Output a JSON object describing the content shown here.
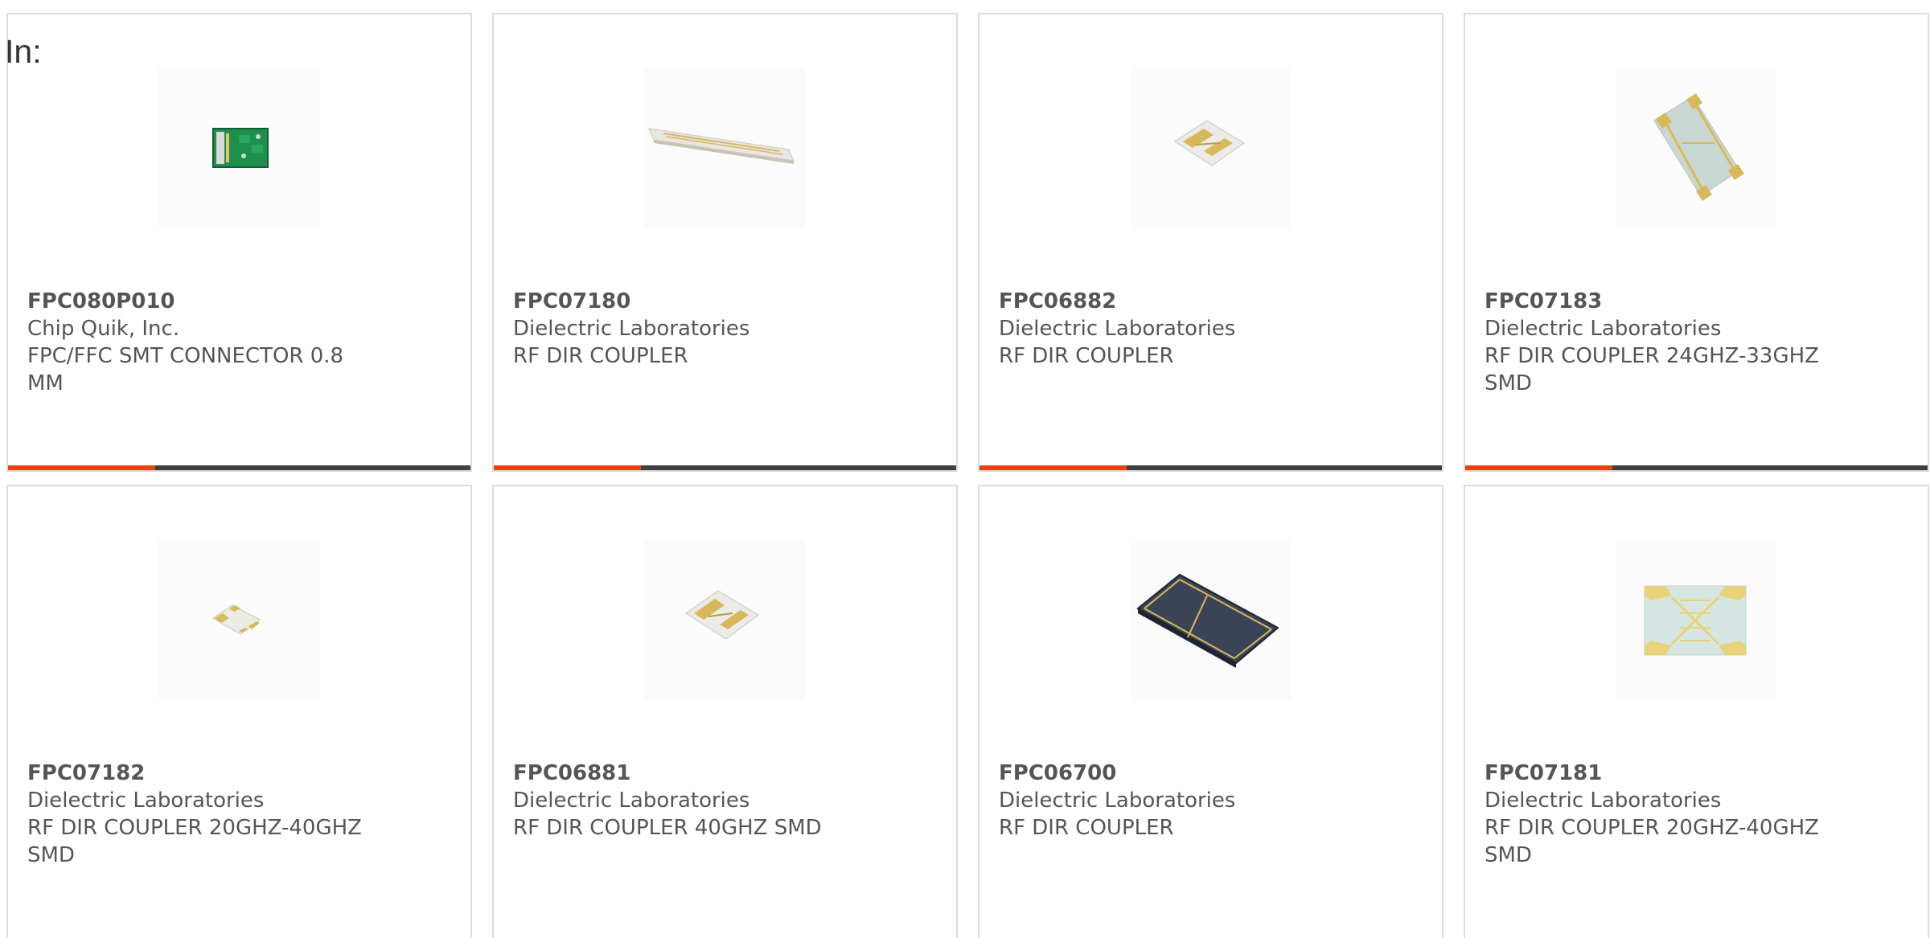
{
  "header": {
    "in_label": "In:"
  },
  "colors": {
    "accent": "#e8430f",
    "bar_track": "#3f3f3f",
    "text": "#555555",
    "border": "#dddddd"
  },
  "products": [
    {
      "part_number": "FPC080P010",
      "manufacturer": "Chip Quik, Inc.",
      "description": "FPC/FFC SMT CONNECTOR 0.8 MM",
      "image_icon": "green-connector-board-icon",
      "progress": 0.32
    },
    {
      "part_number": "FPC07180",
      "manufacturer": "Dielectric Laboratories",
      "description": "RF DIR COUPLER",
      "image_icon": "long-ceramic-coupler-icon",
      "progress": 0.32
    },
    {
      "part_number": "FPC06882",
      "manufacturer": "Dielectric Laboratories",
      "description": "RF DIR COUPLER",
      "image_icon": "small-gold-coupler-icon",
      "progress": 0.32
    },
    {
      "part_number": "FPC07183",
      "manufacturer": "Dielectric Laboratories",
      "description": "RF DIR COUPLER 24GHZ-33GHZ SMD",
      "image_icon": "tilted-gold-frame-coupler-icon",
      "progress": 0.32
    },
    {
      "part_number": "FPC07182",
      "manufacturer": "Dielectric Laboratories",
      "description": "RF DIR COUPLER 20GHZ-40GHZ SMD",
      "image_icon": "tiny-gold-coupler-icon",
      "progress": null
    },
    {
      "part_number": "FPC06881",
      "manufacturer": "Dielectric Laboratories",
      "description": "RF DIR COUPLER 40GHZ SMD",
      "image_icon": "small-gold-coupler-icon",
      "progress": null
    },
    {
      "part_number": "FPC06700",
      "manufacturer": "Dielectric Laboratories",
      "description": "RF DIR COUPLER",
      "image_icon": "dark-blue-coupler-icon",
      "progress": null
    },
    {
      "part_number": "FPC07181",
      "manufacturer": "Dielectric Laboratories",
      "description": "RF DIR COUPLER 20GHZ-40GHZ SMD",
      "image_icon": "flat-gold-pad-coupler-icon",
      "progress": null
    }
  ]
}
